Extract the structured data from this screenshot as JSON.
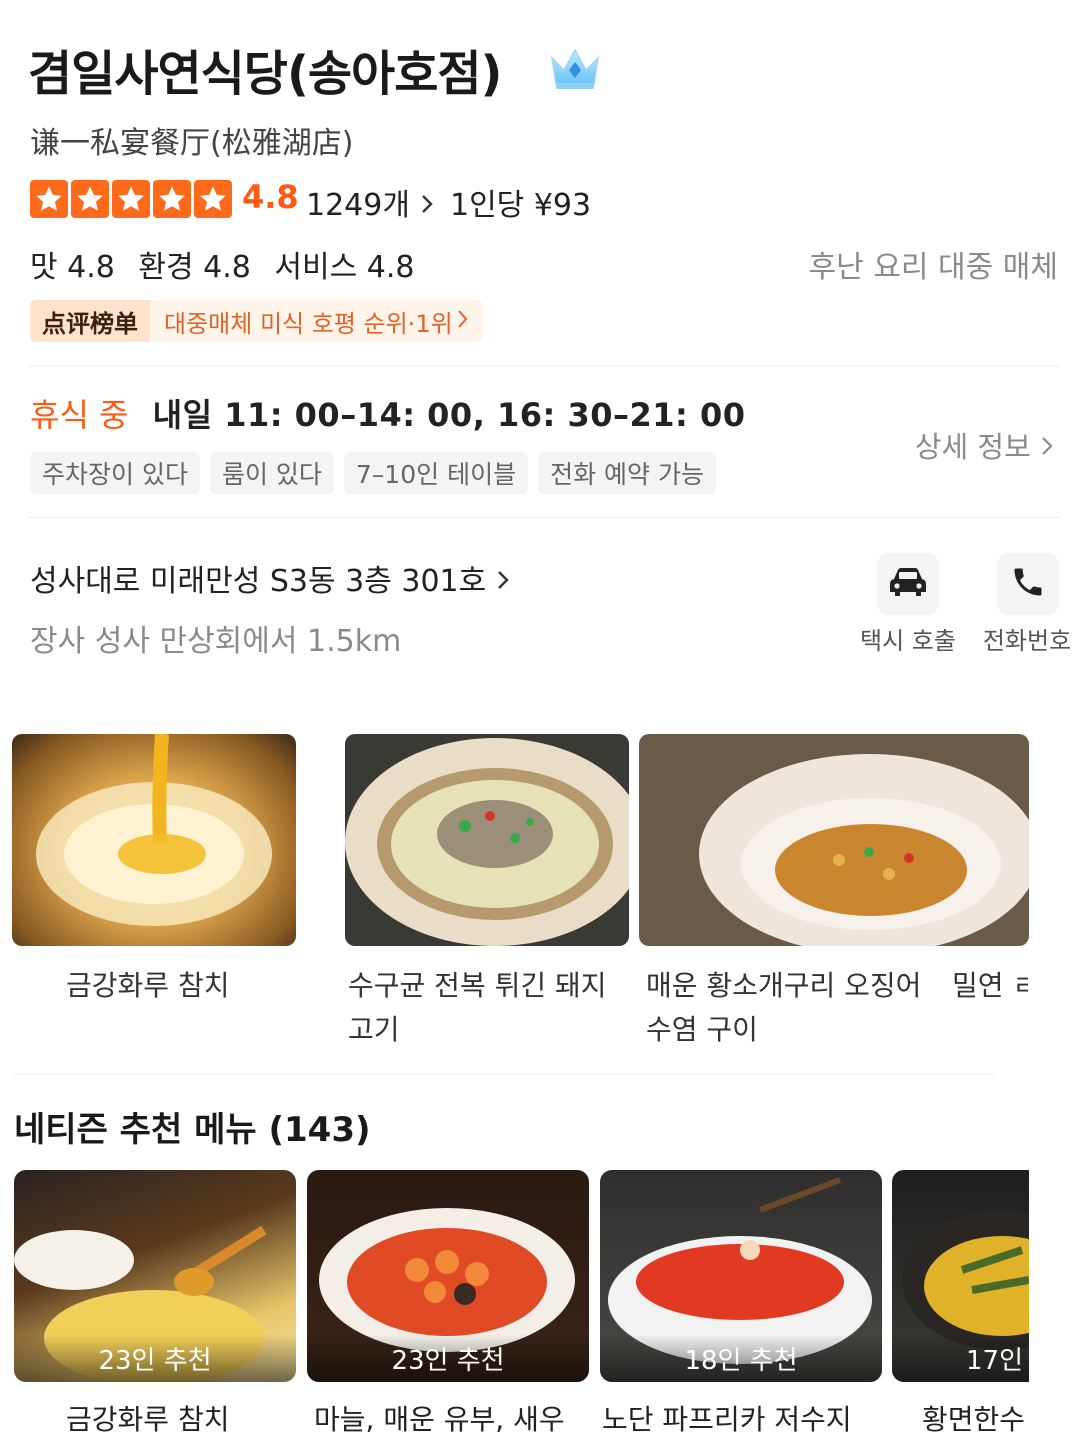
{
  "shop": {
    "name": "겸일사연식당(송아호점)",
    "original_name": "谦一私宴餐厅(松雅湖店)",
    "rating": "4.8",
    "reviews": "1249개",
    "per_person": "1인당 ¥93",
    "scores": [
      "맛 4.8",
      "환경 4.8",
      "서비스 4.8"
    ],
    "cuisine": "후난 요리 대중 매체",
    "rank_tag": "点评榜单",
    "rank_text": "대중매체 미식 호평 순위·1위",
    "status": "휴식 중",
    "hours": "내일 11: 00–14: 00, 16: 30–21: 00",
    "tags": [
      "주차장이 있다",
      "룸이 있다",
      "7–10인 테이블",
      "전화 예약 가능"
    ],
    "detail_link": "상세 정보",
    "address": "성사대로 미래만성 S3동 3층 301호",
    "distance": "장사 성사 만상회에서 1.5km",
    "actions": {
      "taxi": "택시 호출",
      "phone": "전화번호"
    }
  },
  "dishes": [
    {
      "name": "금강화루 참치"
    },
    {
      "name": "수구균 전복 튀긴 돼지 고기"
    },
    {
      "name": "매운 황소개구리 오징어 수염 구이"
    },
    {
      "name": "밀연 ㄹ"
    }
  ],
  "recommend": {
    "title": "네티즌 추천 메뉴 (143)",
    "items": [
      {
        "count": "23인 추천",
        "name": "금강화루 참치"
      },
      {
        "count": "23인 추천",
        "name": "마늘, 매운 유부, 새우"
      },
      {
        "count": "18인 추천",
        "name": "노단 파프리카 저수지"
      },
      {
        "count": "17인",
        "name": "황면한수"
      }
    ]
  },
  "colors": {
    "accent": "#ff5a14",
    "muted": "#8a8a8a"
  }
}
